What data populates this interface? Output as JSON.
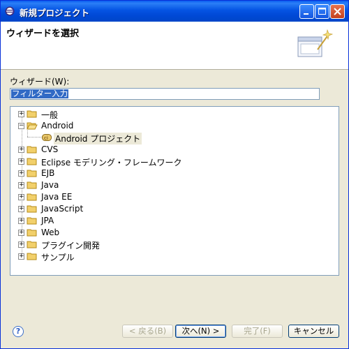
{
  "window": {
    "title": "新規プロジェクト"
  },
  "header": {
    "title": "ウィザードを選択"
  },
  "wizard_label": "ウィザード(W):",
  "filter": {
    "selected_text": "フィルター入力"
  },
  "tree": {
    "items": [
      {
        "label": "一般",
        "expanded": false
      },
      {
        "label": "Android",
        "expanded": true
      },
      {
        "label": "Android プロジェクト",
        "child": true
      },
      {
        "label": "CVS",
        "expanded": false
      },
      {
        "label": "Eclipse モデリング・フレームワーク",
        "expanded": false
      },
      {
        "label": "EJB",
        "expanded": false
      },
      {
        "label": "Java",
        "expanded": false
      },
      {
        "label": "Java EE",
        "expanded": false
      },
      {
        "label": "JavaScript",
        "expanded": false
      },
      {
        "label": "JPA",
        "expanded": false
      },
      {
        "label": "Web",
        "expanded": false
      },
      {
        "label": "プラグイン開発",
        "expanded": false
      },
      {
        "label": "サンプル",
        "expanded": false
      }
    ]
  },
  "buttons": {
    "help": "?",
    "back": "< 戻る(B)",
    "next": "次へ(N) >",
    "finish": "完了(F)",
    "cancel": "キャンセル"
  },
  "colors": {
    "titlebar": "#0054e3",
    "folder": "#f2d06b",
    "selection": "#316ac5"
  }
}
